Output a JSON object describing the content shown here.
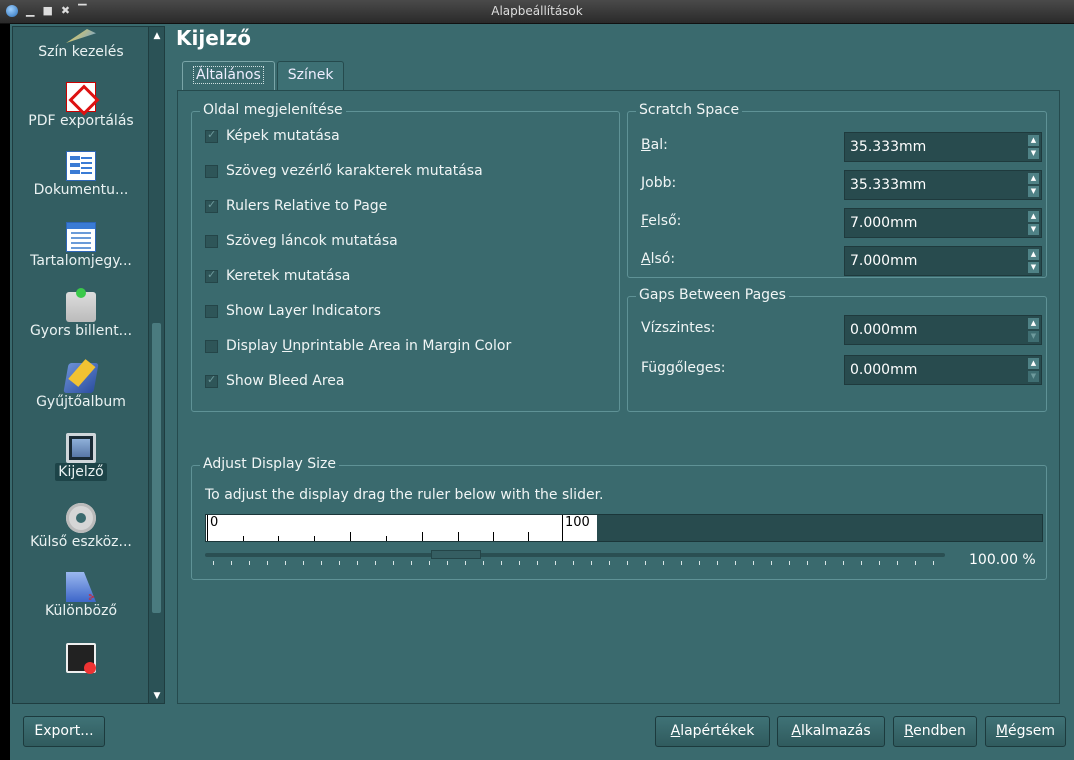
{
  "window": {
    "title": "Alapbeállítások"
  },
  "sidebar": {
    "items": [
      {
        "label": "Szín kezelés"
      },
      {
        "label": "PDF exportálás"
      },
      {
        "label": "Dokumentu..."
      },
      {
        "label": "Tartalomjegy..."
      },
      {
        "label": "Gyors billent..."
      },
      {
        "label": "Gyűjtőalbum"
      },
      {
        "label": "Kijelző"
      },
      {
        "label": "Külső eszköz..."
      },
      {
        "label": "Különböző"
      }
    ]
  },
  "page": {
    "title": "Kijelző"
  },
  "tabs": [
    {
      "label": "Általános"
    },
    {
      "label": "Színek"
    }
  ],
  "page_display": {
    "title": "Oldal megjelenítése",
    "options": [
      {
        "label": "Képek mutatása",
        "checked": true
      },
      {
        "label": "Szöveg vezérlő karakterek mutatása",
        "checked": false
      },
      {
        "label": "Rulers Relative to Page",
        "checked": true
      },
      {
        "label": "Szöveg láncok mutatása",
        "checked": false
      },
      {
        "label": "Keretek mutatása",
        "checked": true
      },
      {
        "label": "Show Layer Indicators",
        "checked": false
      },
      {
        "label_pre": "Display ",
        "label_mn": "U",
        "label_post": "nprintable Area in Margin Color",
        "checked": false
      },
      {
        "label": "Show Bleed Area",
        "checked": true
      }
    ]
  },
  "scratch_space": {
    "title": "Scratch Space",
    "fields": [
      {
        "mn": "B",
        "rest": "al:",
        "value": "35.333mm"
      },
      {
        "mn": "J",
        "rest": "obb:",
        "value": "35.333mm"
      },
      {
        "mn": "F",
        "rest": "első:",
        "value": "7.000mm"
      },
      {
        "mn": "A",
        "rest": "lsó:",
        "value": "7.000mm"
      }
    ]
  },
  "gaps": {
    "title": "Gaps Between Pages",
    "fields": [
      {
        "label": "Vízszintes:",
        "value": "0.000mm"
      },
      {
        "label": "Függőleges:",
        "value": "0.000mm"
      }
    ]
  },
  "display_size": {
    "title": "Adjust Display Size",
    "hint": "To adjust the display drag the ruler below with the slider.",
    "ruler_start": "0",
    "ruler_end": "100",
    "percent": "100.00 %"
  },
  "buttons": {
    "export": "Export...",
    "defaults": {
      "mn": "A",
      "rest": "lapértékek"
    },
    "apply": {
      "mn": "A",
      "rest": "lkalmazás"
    },
    "ok": {
      "mn": "R",
      "rest": "endben"
    },
    "cancel": {
      "mn": "M",
      "rest": "égsem"
    }
  }
}
